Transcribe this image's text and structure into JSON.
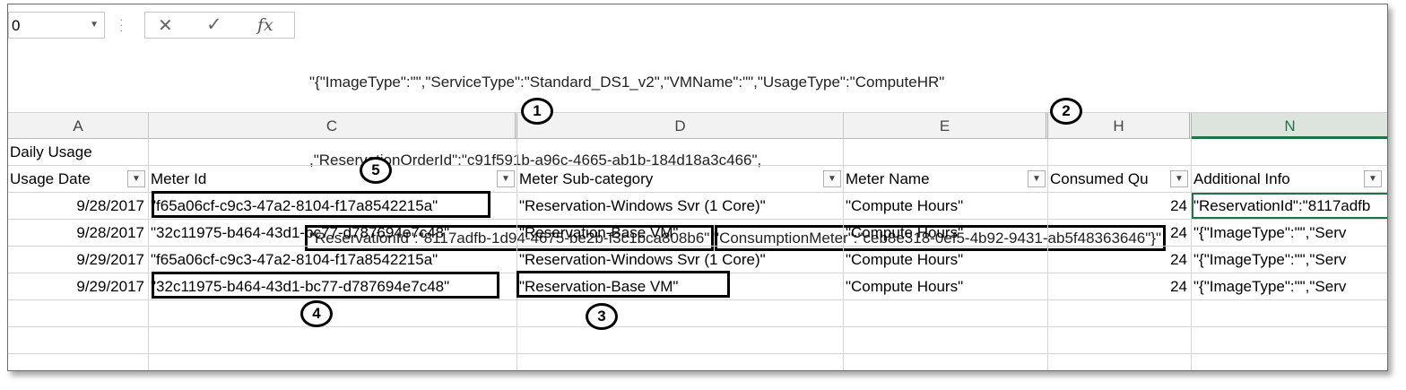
{
  "name_box": {
    "value": "0"
  },
  "formula_bar": {
    "line1": "\"{\"ImageType\":\"\",\"ServiceType\":\"Standard_DS1_v2\",\"VMName\":\"\",\"UsageType\":\"ComputeHR\"",
    "line2": ",\"ReservationOrderId\":\"c91f591b-a96c-4665-ab1b-184d18a3c466\",",
    "line3_part1": "\"ReservationId\":\"8117adfb-1d94-4675-be2b-f3c1bca808b6\"",
    "line3_sep": ",\"",
    "line3_part2": "ConsumptionMeter\":\"ceb8e318-0ef5-4b92-9431-ab5f48363646\"}\"",
    "cancel_icon": "close-icon",
    "enter_icon": "check-icon",
    "function_icon": "fx-icon"
  },
  "callouts": [
    "1",
    "2",
    "3",
    "4",
    "5"
  ],
  "columns": [
    "A",
    "C",
    "D",
    "E",
    "H",
    "N"
  ],
  "title_row": {
    "a": "Daily Usage"
  },
  "headers": {
    "usage_date": "Usage Date",
    "meter_id": "Meter Id",
    "meter_subcategory": "Meter Sub-category",
    "meter_name": "Meter Name",
    "consumed_qty": "Consumed Qu",
    "additional_info": "Additional Info"
  },
  "rows": [
    {
      "date": "9/28/2017",
      "meter_id": "\"f65a06cf-c9c3-47a2-8104-f17a8542215a\"",
      "subcat": "\"Reservation-Windows Svr (1 Core)\"",
      "name": "\"Compute Hours\"",
      "qty": "24",
      "info": "\"ReservationId\":\"8117adfb"
    },
    {
      "date": "9/28/2017",
      "meter_id": "\"32c11975-b464-43d1-bc77-d787694e7c48\"",
      "subcat": "\"Reservation-Base VM\"",
      "name": "\"Compute Hours\"",
      "qty": "24",
      "info": "\"{\"ImageType\":\"\",\"Serv"
    },
    {
      "date": "9/29/2017",
      "meter_id": "\"f65a06cf-c9c3-47a2-8104-f17a8542215a\"",
      "subcat": "\"Reservation-Windows Svr (1 Core)\"",
      "name": "\"Compute Hours\"",
      "qty": "24",
      "info": "\"{\"ImageType\":\"\",\"Serv"
    },
    {
      "date": "9/29/2017",
      "meter_id": "\"32c11975-b464-43d1-bc77-d787694e7c48\"",
      "subcat": "\"Reservation-Base VM\"",
      "name": "\"Compute Hours\"",
      "qty": "24",
      "info": "\"{\"ImageType\":\"\",\"Serv"
    }
  ],
  "colors": {
    "selection": "#217346",
    "header_bg": "#f2f2f2",
    "gridline": "#d4d4d4"
  }
}
